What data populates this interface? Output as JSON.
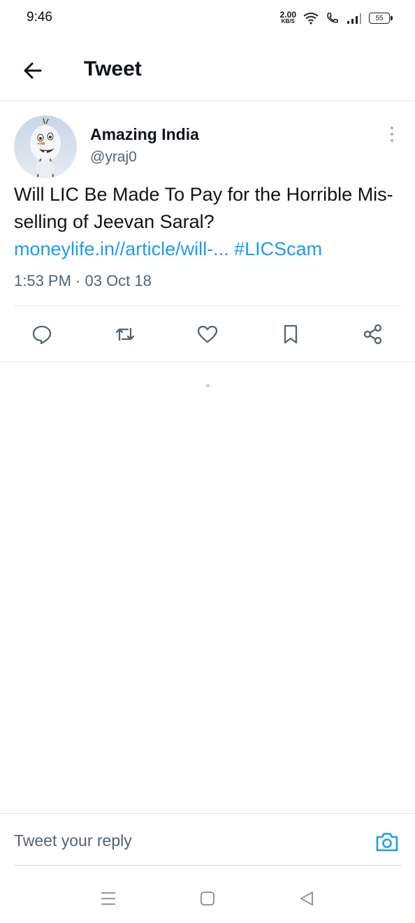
{
  "status_bar": {
    "time": "9:46",
    "net_speed_value": "2.00",
    "net_speed_unit": "KB/S",
    "battery": "55"
  },
  "header": {
    "title": "Tweet",
    "back_icon": "arrow-left-icon"
  },
  "tweet": {
    "author_name": "Amazing India",
    "author_handle": "@yraj0",
    "text": "Will LIC Be Made To Pay for the Horrible Mis-selling of Jeevan Saral?",
    "link_text": "moneylife.in//article/will-...",
    "hashtag": "#LICScam",
    "timestamp": "1:53 PM · 03 Oct 18"
  },
  "actions": [
    {
      "name": "reply",
      "icon": "reply-icon"
    },
    {
      "name": "retweet",
      "icon": "retweet-icon"
    },
    {
      "name": "like",
      "icon": "heart-icon"
    },
    {
      "name": "bookmark",
      "icon": "bookmark-icon"
    },
    {
      "name": "share",
      "icon": "share-icon"
    }
  ],
  "reply": {
    "placeholder": "Tweet your reply",
    "camera_icon": "camera-icon"
  },
  "colors": {
    "accent": "#1d9bf0",
    "text": "#0f1419",
    "secondary": "#536471",
    "divider": "#e6e8eb"
  }
}
